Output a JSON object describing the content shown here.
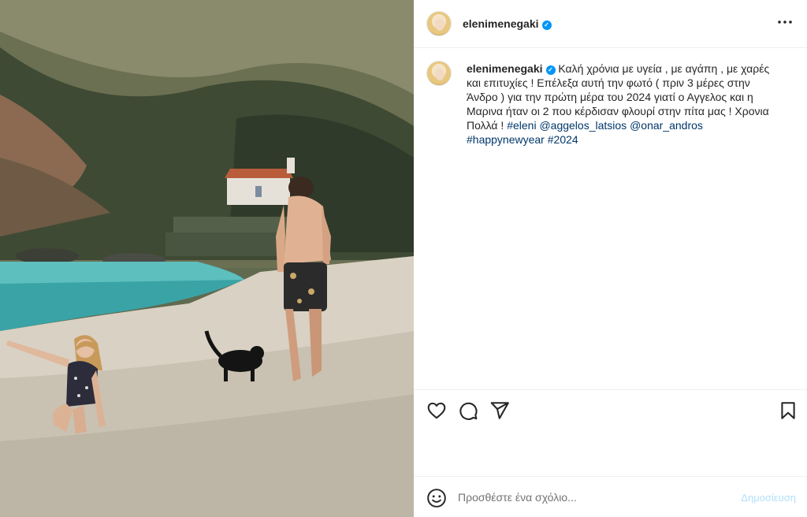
{
  "post": {
    "username": "elenimenegaki",
    "verified_mark": "✓",
    "more_icon": "more-horizontal-icon"
  },
  "caption": {
    "username": "elenimenegaki",
    "text": "Καλή χρόνια με υγεία , με αγάπη , με χαρές και επιτυχίες ! Επέλεξα αυτή την φωτό ( πριν 3 μέρες στην Άνδρο ) για την πρώτη μέρα του 2024 γιατί ο Αγγελος και η Μαρινα ήταν οι 2 που κέρδισαν φλουρί στην πίτα μας ! Χρονια Πολλά ! ",
    "tags": [
      "#eleni",
      "@aggelos_latsios",
      "@onar_andros",
      "#happynewyear",
      "#2024"
    ]
  },
  "actions": {
    "icons": [
      "heart-icon",
      "comment-icon",
      "share-icon",
      "bookmark-icon"
    ]
  },
  "comment": {
    "placeholder": "Προσθέστε ένα σχόλιο...",
    "post_label": "Δημοσίευση",
    "emoji_icon": "emoji-icon"
  },
  "colors": {
    "link": "#00376b",
    "verified": "#0095f6",
    "post_disabled": "#b2dffc"
  }
}
